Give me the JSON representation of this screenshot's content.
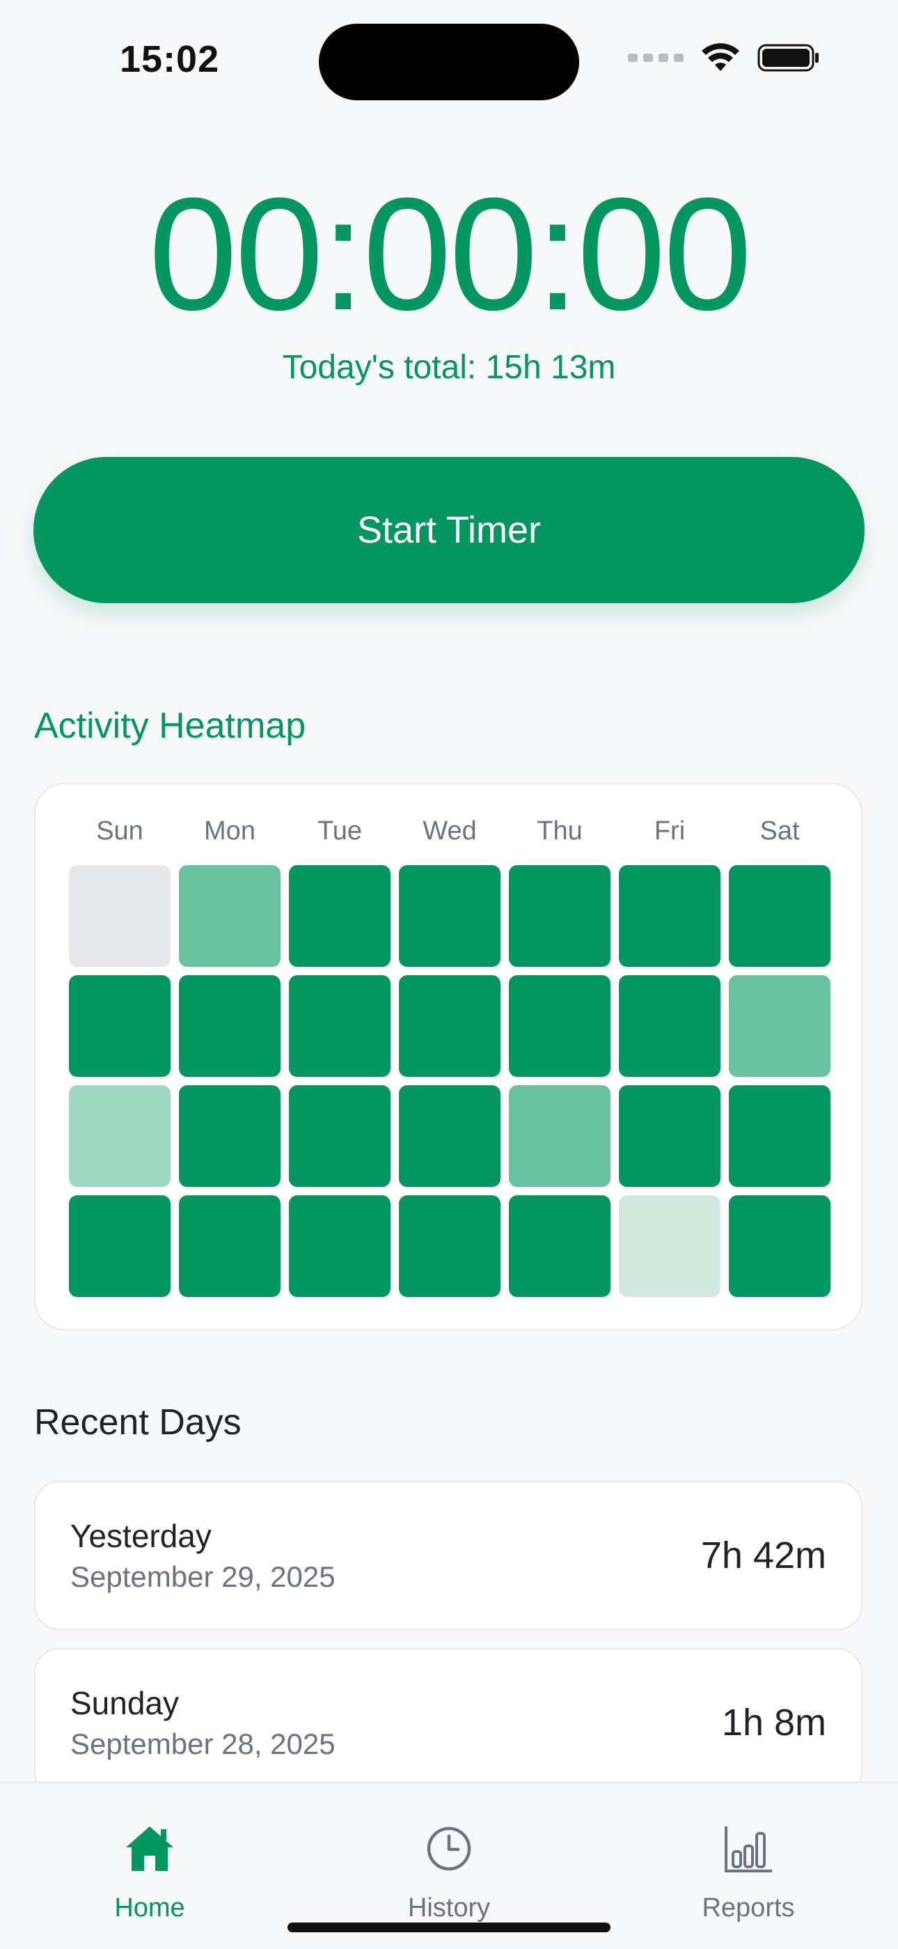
{
  "status_bar": {
    "time": "15:02"
  },
  "timer": {
    "display": "00:00:00",
    "today_total": "Today's total: 15h 13m"
  },
  "start_button": {
    "label": "Start Timer"
  },
  "heatmap": {
    "title": "Activity Heatmap",
    "days": [
      "Sun",
      "Mon",
      "Tue",
      "Wed",
      "Thu",
      "Fri",
      "Sat"
    ],
    "levels": [
      [
        0,
        3,
        4,
        4,
        4,
        4,
        4
      ],
      [
        4,
        4,
        4,
        4,
        4,
        4,
        3
      ],
      [
        2,
        4,
        4,
        4,
        3,
        4,
        4
      ],
      [
        4,
        4,
        4,
        4,
        4,
        1,
        4
      ]
    ],
    "level_colors": [
      "#e6e7ea",
      "#cfe9df",
      "#9ed8c2",
      "#68c19f",
      "#039660"
    ]
  },
  "recent_days": {
    "title": "Recent Days",
    "items": [
      {
        "name": "Yesterday",
        "date": "September 29, 2025",
        "duration": "7h 42m"
      },
      {
        "name": "Sunday",
        "date": "September 28, 2025",
        "duration": "1h 8m"
      }
    ]
  },
  "tabs": [
    {
      "label": "Home",
      "icon": "house-icon",
      "active": true
    },
    {
      "label": "History",
      "icon": "clock-icon",
      "active": false
    },
    {
      "label": "Reports",
      "icon": "bar-chart-icon",
      "active": false
    }
  ],
  "colors": {
    "accent": "#039660",
    "inactive": "#6b7280",
    "background": "#f7f8fa"
  }
}
